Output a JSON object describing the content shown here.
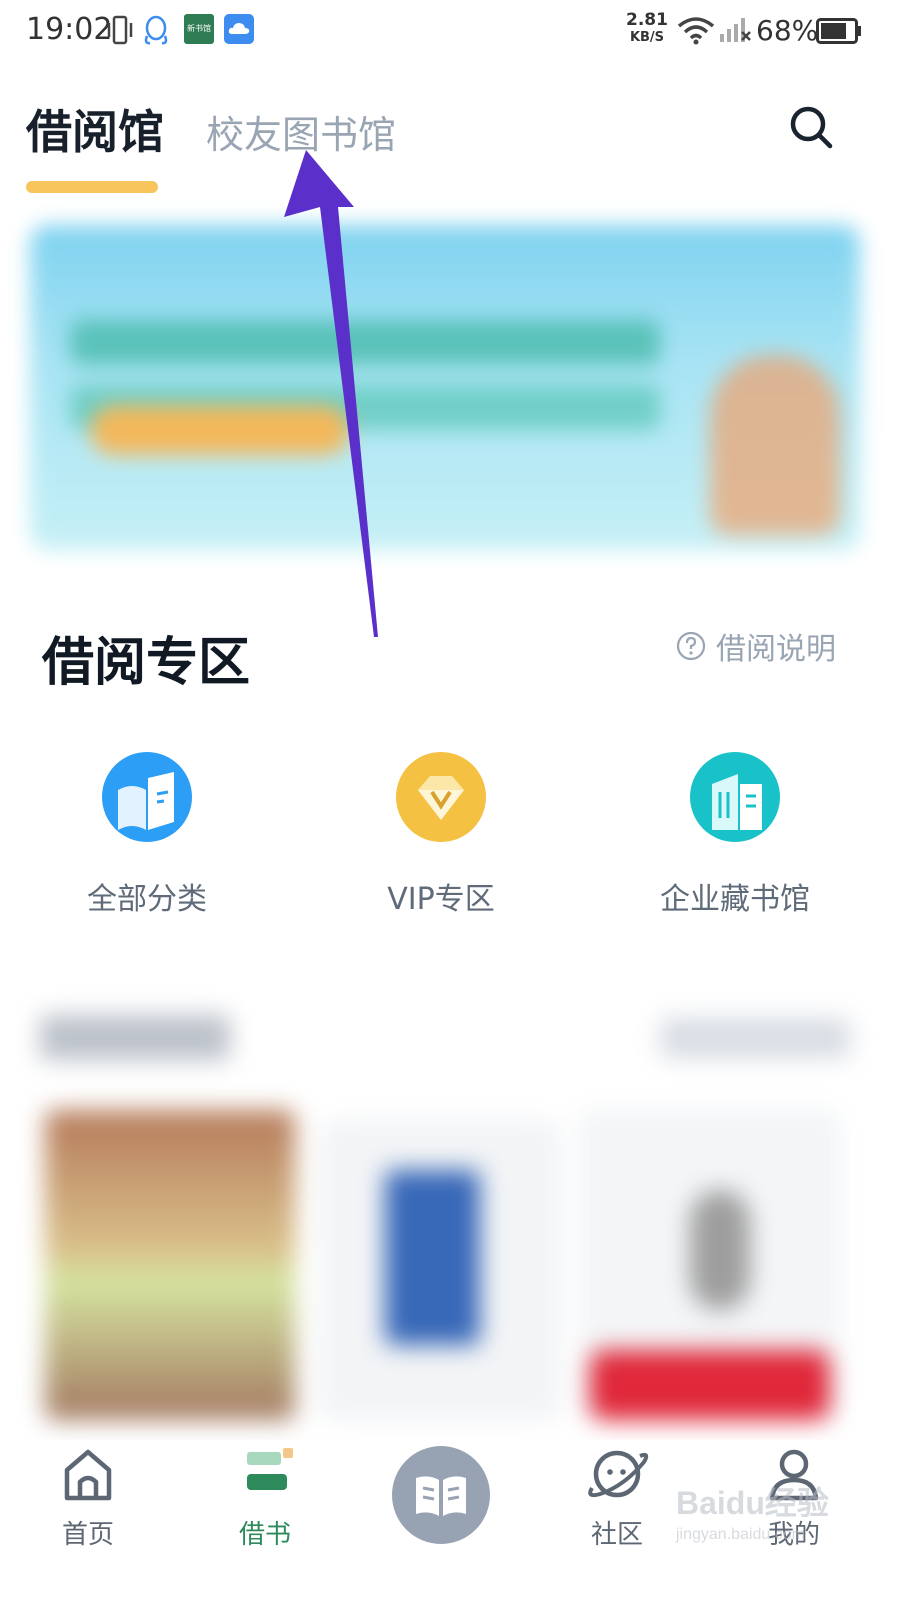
{
  "status_bar": {
    "time": "19:02",
    "net_speed_value": "2.81",
    "net_speed_unit": "KB/S",
    "battery_percent": "68%",
    "app_icon_text": "新书馆"
  },
  "top_tabs": {
    "active": "借阅馆",
    "inactive": "校友图书馆",
    "underline_color": "#f7c55c"
  },
  "section": {
    "title": "借阅专区",
    "help_label": "借阅说明"
  },
  "categories": [
    {
      "label": "全部分类",
      "icon": "book-icon",
      "color": "#2c9ef5"
    },
    {
      "label": "VIP专区",
      "icon": "vip-diamond-icon",
      "color": "#f5c142"
    },
    {
      "label": "企业藏书馆",
      "icon": "building-icon",
      "color": "#19c1c9"
    }
  ],
  "bottom_nav": {
    "items": [
      {
        "label": "首页",
        "icon": "home-icon"
      },
      {
        "label": "借书",
        "icon": "borrow-books-icon",
        "active": true
      },
      {
        "label": "",
        "icon": "open-book-icon"
      },
      {
        "label": "社区",
        "icon": "planet-icon"
      },
      {
        "label": "我的",
        "icon": "user-icon"
      }
    ],
    "active_color": "#2d8a5a"
  },
  "watermark": {
    "brand": "Baidu经验",
    "url": "jingyan.baidu.com"
  },
  "annotation": {
    "arrow_color": "#5b2fc9"
  }
}
